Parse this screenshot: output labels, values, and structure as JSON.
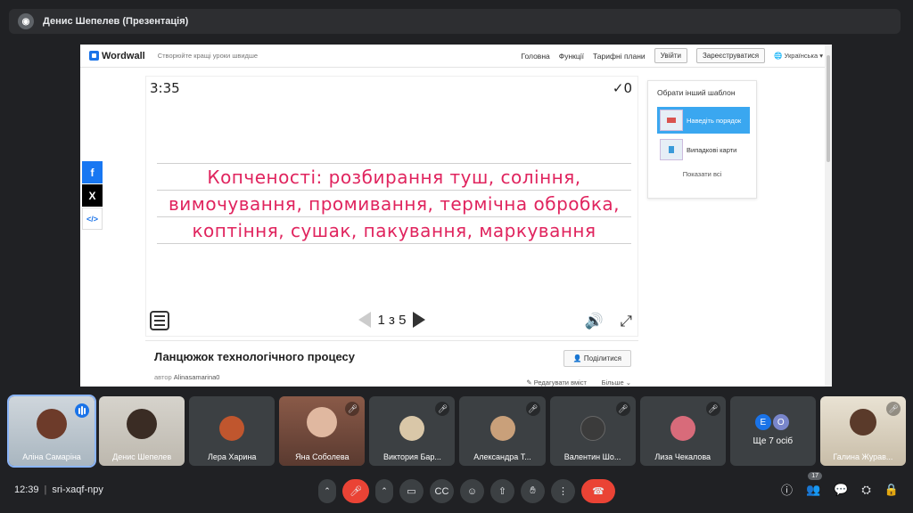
{
  "presentation_bar": {
    "title": "Денис Шепелев (Презентація)"
  },
  "wordwall": {
    "logo": "Wordwall",
    "tagline": "Створюйте кращі уроки швидше",
    "nav": [
      "Головна",
      "Функції",
      "Тарифні плани"
    ],
    "login": "Увійти",
    "register": "Зареєструватися",
    "language": "Українська",
    "game": {
      "timer": "3:35",
      "score": "0",
      "lines": [
        "Копченості: розбирання туш, соління,",
        "вимочування, промивання, термічна обробка,",
        "коптіння, сушак, пакування, маркування"
      ],
      "pager": "1 з 5"
    },
    "activity_title": "Ланцюжок технологічного процесу",
    "author_label": "автор",
    "author": "Alinasamarina0",
    "share": "Поділитися",
    "edit": "Редагувати вміст",
    "more": "Більше",
    "side_panel": {
      "title": "Обрати інший шаблон",
      "templates": [
        "Наведіть порядок",
        "Випадкові карти"
      ],
      "show_all": "Показати всі"
    },
    "social": {
      "fb": "f",
      "x": "X",
      "embed": "</>"
    }
  },
  "participants": [
    {
      "name": "Аліна Самаріна",
      "speaking": true
    },
    {
      "name": "Денис Шепелев"
    },
    {
      "name": "Лера Харина"
    },
    {
      "name": "Яна Соболева"
    },
    {
      "name": "Виктория Бар..."
    },
    {
      "name": "Александра Т..."
    },
    {
      "name": "Валентин Шо..."
    },
    {
      "name": "Лиза Чекалова"
    },
    {
      "name": "Ще 7 осіб",
      "initials": [
        "E",
        "O"
      ]
    },
    {
      "name": "Галина Журав..."
    }
  ],
  "bottom": {
    "time": "12:39",
    "meeting_code": "sri-xaqf-npy",
    "people_count": "17"
  }
}
